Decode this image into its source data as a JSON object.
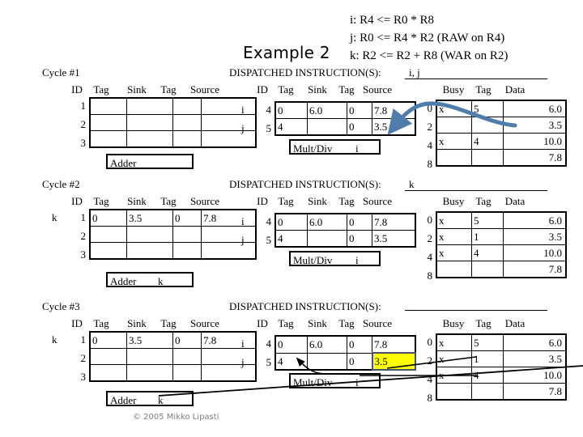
{
  "title": "Example 2",
  "instructions": [
    "i: R4 <= R0 * R8",
    "j: R0 <= R4 * R2 (RAW on R4)",
    "k: R2 <= R2 + R8 (WAR on R2)"
  ],
  "copyright": "© 2005 Mikko Lipasti",
  "labels": {
    "dispatched": "DISPATCHED INSTRUCTION(S):",
    "cycle1": "Cycle #1",
    "cycle2": "Cycle #2",
    "cycle3": "Cycle #3",
    "id": "ID",
    "tag": "Tag",
    "sink": "Sink",
    "tag2": "Tag",
    "source": "Source",
    "busy": "Busy",
    "data": "Data",
    "adder": "Adder",
    "multdiv": "Mult/Div"
  },
  "colors": {
    "highlight_fill": "#ffff00",
    "highlight_border": "#44546a",
    "blue_arrow": "#4f7dab",
    "black_arrow": "#000000",
    "copyright_text": "#808080"
  },
  "cycle1": {
    "label": "Cycle #1",
    "rule_tag": "i, j",
    "rs": {
      "row_ids": [
        "1",
        "2",
        "3"
      ],
      "row_tags": [
        "",
        "",
        ""
      ],
      "rows": [
        {
          "tag": "",
          "sink": "",
          "tag2": "",
          "source": ""
        },
        {
          "tag": "",
          "sink": "",
          "tag2": "",
          "source": ""
        },
        {
          "tag": "",
          "sink": "",
          "tag2": "",
          "source": ""
        }
      ],
      "fu_name": "Adder",
      "fu_tag": ""
    },
    "dispatch": {
      "row_tags": [
        "i",
        "j"
      ],
      "row_ids": [
        "4",
        "5"
      ],
      "rows": [
        {
          "tag": "0",
          "sink": "6.0",
          "tag2": "0",
          "source": "7.8",
          "source_highlight": false
        },
        {
          "tag": "4",
          "sink": "",
          "tag2": "0",
          "source": "3.5",
          "source_highlight": false
        }
      ],
      "fu_name": "Mult/Div",
      "fu_tag": "i"
    },
    "regfile": {
      "row_ids": [
        "0",
        "2",
        "4",
        "8"
      ],
      "rows": [
        {
          "busy": "x",
          "tag": "5",
          "data": "6.0"
        },
        {
          "busy": "",
          "tag": "",
          "data": "3.5"
        },
        {
          "busy": "x",
          "tag": "4",
          "data": "10.0"
        },
        {
          "busy": "",
          "tag": "",
          "data": "7.8"
        }
      ]
    }
  },
  "cycle2": {
    "label": "Cycle #2",
    "rule_tag": "k",
    "rs": {
      "row_ids": [
        "1",
        "2",
        "3"
      ],
      "row_tags": [
        "k",
        "",
        ""
      ],
      "rows": [
        {
          "tag": "0",
          "sink": "3.5",
          "tag2": "0",
          "source": "7.8"
        },
        {
          "tag": "",
          "sink": "",
          "tag2": "",
          "source": ""
        },
        {
          "tag": "",
          "sink": "",
          "tag2": "",
          "source": ""
        }
      ],
      "fu_name": "Adder",
      "fu_tag": "k"
    },
    "dispatch": {
      "row_tags": [
        "i",
        "j"
      ],
      "row_ids": [
        "4",
        "5"
      ],
      "rows": [
        {
          "tag": "0",
          "sink": "6.0",
          "tag2": "0",
          "source": "7.8",
          "source_highlight": false
        },
        {
          "tag": "4",
          "sink": "",
          "tag2": "0",
          "source": "3.5",
          "source_highlight": false
        }
      ],
      "fu_name": "Mult/Div",
      "fu_tag": "i"
    },
    "regfile": {
      "row_ids": [
        "0",
        "2",
        "4",
        "8"
      ],
      "rows": [
        {
          "busy": "x",
          "tag": "5",
          "data": "6.0"
        },
        {
          "busy": "x",
          "tag": "1",
          "data": "3.5"
        },
        {
          "busy": "x",
          "tag": "4",
          "data": "10.0"
        },
        {
          "busy": "",
          "tag": "",
          "data": "7.8"
        }
      ]
    }
  },
  "cycle3": {
    "label": "Cycle #3",
    "rule_tag": "",
    "rs": {
      "row_ids": [
        "1",
        "2",
        "3"
      ],
      "row_tags": [
        "k",
        "",
        ""
      ],
      "rows": [
        {
          "tag": "0",
          "sink": "3.5",
          "tag2": "0",
          "source": "7.8"
        },
        {
          "tag": "",
          "sink": "",
          "tag2": "",
          "source": ""
        },
        {
          "tag": "",
          "sink": "",
          "tag2": "",
          "source": ""
        }
      ],
      "fu_name": "Adder",
      "fu_tag": "k"
    },
    "dispatch": {
      "row_tags": [
        "i",
        "j"
      ],
      "row_ids": [
        "4",
        "5"
      ],
      "rows": [
        {
          "tag": "0",
          "sink": "6.0",
          "tag2": "0",
          "source": "7.8",
          "source_highlight": false
        },
        {
          "tag": "4",
          "sink": "",
          "tag2": "0",
          "source": "3.5",
          "source_highlight": true
        }
      ],
      "fu_name": "Mult/Div",
      "fu_tag": "i"
    },
    "regfile": {
      "row_ids": [
        "0",
        "2",
        "4",
        "8"
      ],
      "rows": [
        {
          "busy": "x",
          "tag": "5",
          "data": "6.0"
        },
        {
          "busy": "x",
          "tag": "1",
          "data": "3.5"
        },
        {
          "busy": "x",
          "tag": "4",
          "data": "10.0"
        },
        {
          "busy": "",
          "tag": "",
          "data": "7.8"
        }
      ]
    }
  }
}
